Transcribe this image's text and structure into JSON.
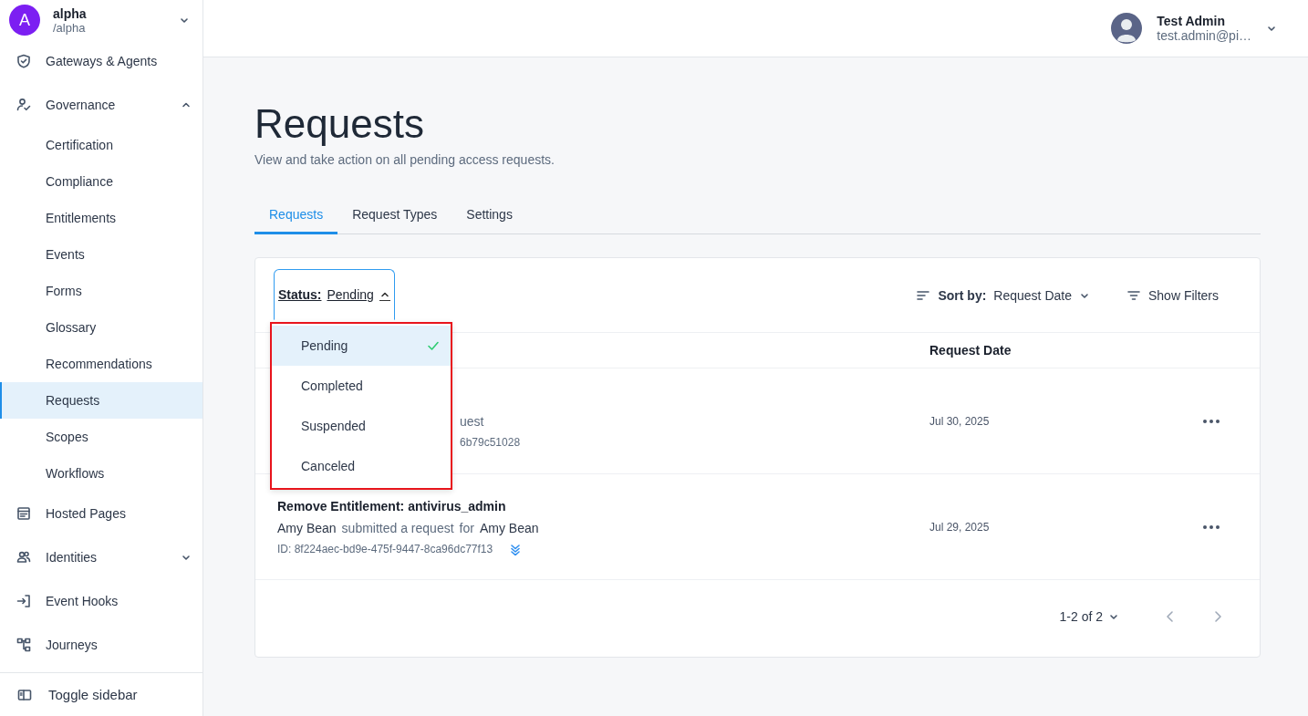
{
  "org": {
    "initial": "A",
    "name": "alpha",
    "path": "/alpha"
  },
  "sidebar": {
    "items": [
      {
        "label": "Gateways & Agents",
        "selected": false
      },
      {
        "label": "Governance",
        "selected": false,
        "expanded": true,
        "children": [
          {
            "label": "Certification",
            "selected": false
          },
          {
            "label": "Compliance",
            "selected": false
          },
          {
            "label": "Entitlements",
            "selected": false
          },
          {
            "label": "Events",
            "selected": false
          },
          {
            "label": "Forms",
            "selected": false
          },
          {
            "label": "Glossary",
            "selected": false
          },
          {
            "label": "Recommendations",
            "selected": false
          },
          {
            "label": "Requests",
            "selected": true
          },
          {
            "label": "Scopes",
            "selected": false
          },
          {
            "label": "Workflows",
            "selected": false
          }
        ]
      },
      {
        "label": "Hosted Pages",
        "selected": false
      },
      {
        "label": "Identities",
        "selected": false,
        "expanded": false
      },
      {
        "label": "Event Hooks",
        "selected": false
      },
      {
        "label": "Journeys",
        "selected": false
      }
    ],
    "footer": "Toggle sidebar"
  },
  "user": {
    "name": "Test Admin",
    "email": "test.admin@pi…"
  },
  "page": {
    "title": "Requests",
    "subtitle": "View and take action on all pending access requests."
  },
  "tabs": [
    {
      "label": "Requests",
      "selected": true
    },
    {
      "label": "Request Types",
      "selected": false
    },
    {
      "label": "Settings",
      "selected": false
    }
  ],
  "filter": {
    "label": "Status:",
    "value": "Pending",
    "open": true,
    "options": [
      {
        "label": "Pending",
        "selected": true
      },
      {
        "label": "Completed",
        "selected": false
      },
      {
        "label": "Suspended",
        "selected": false
      },
      {
        "label": "Canceled",
        "selected": false
      }
    ]
  },
  "sort": {
    "label": "Sort by:",
    "value": "Request Date"
  },
  "show_filters": "Show Filters",
  "table": {
    "columns": [
      "Request Date"
    ],
    "rows": [
      {
        "kind": "covered",
        "summary": "uest",
        "id": "6b79c51028",
        "date": "Jul 30, 2025"
      },
      {
        "kind": "full",
        "title": "Remove Entitlement: antivirus_admin",
        "requester": "Amy Bean",
        "action": "submitted a request",
        "for": "for",
        "target": "Amy Bean",
        "id": "ID: 8f224aec-bd9e-475f-9447-8ca96dc77f13",
        "date": "Jul 29, 2025"
      }
    ]
  },
  "pagination": {
    "range": "1-2 of 2"
  }
}
